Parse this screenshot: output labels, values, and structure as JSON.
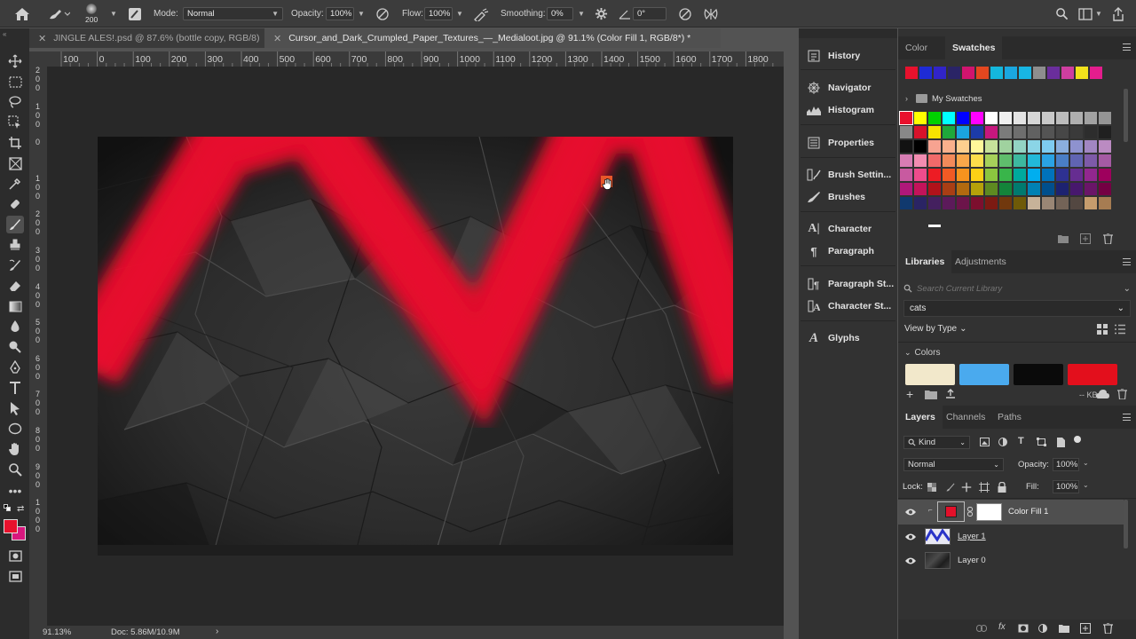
{
  "options_bar": {
    "brush_size": "200",
    "mode_label": "Mode:",
    "mode_value": "Normal",
    "opacity_label": "Opacity:",
    "opacity_value": "100%",
    "flow_label": "Flow:",
    "flow_value": "100%",
    "smoothing_label": "Smoothing:",
    "smoothing_value": "0%",
    "angle_value": "0°"
  },
  "tabs": [
    {
      "label": "JINGLE ALES!.psd @ 87.6% (bottle copy, RGB/8)",
      "active": false
    },
    {
      "label": "Cursor_and_Dark_Crumpled_Paper_Textures_—_Medialoot.jpg @ 91.1% (Color Fill 1, RGB/8*) *",
      "active": true
    }
  ],
  "ruler": {
    "top_ticks": [
      "100",
      "0",
      "100",
      "200",
      "300",
      "400",
      "500",
      "600",
      "700",
      "800",
      "900",
      "1000",
      "1100",
      "1200",
      "1300",
      "1400",
      "1500",
      "1600",
      "1700",
      "1800"
    ],
    "left_groups": [
      [
        "2",
        "0",
        "0"
      ],
      [
        "1",
        "0",
        "0"
      ],
      [
        "0"
      ],
      [
        "1",
        "0",
        "0"
      ],
      [
        "2",
        "0",
        "0"
      ],
      [
        "3",
        "0",
        "0"
      ],
      [
        "4",
        "0",
        "0"
      ],
      [
        "5",
        "0",
        "0"
      ],
      [
        "6",
        "0",
        "0"
      ],
      [
        "7",
        "0",
        "0"
      ],
      [
        "8",
        "0",
        "0"
      ],
      [
        "9",
        "0",
        "0"
      ],
      [
        "1",
        "0",
        "0",
        "0"
      ]
    ]
  },
  "status": {
    "zoom": "91.13%",
    "doc": "Doc: 5.86M/10.9M"
  },
  "mid_panel": [
    {
      "label": "History",
      "icon": "history-icon"
    },
    {
      "label": "Navigator",
      "icon": "navigator-icon"
    },
    {
      "label": "Histogram",
      "icon": "histogram-icon"
    },
    {
      "label": "Properties",
      "icon": "properties-icon"
    },
    {
      "label": "Brush Settin...",
      "icon": "brush-settings-icon"
    },
    {
      "label": "Brushes",
      "icon": "brushes-icon"
    },
    {
      "label": "Character",
      "icon": "character-icon"
    },
    {
      "label": "Paragraph",
      "icon": "paragraph-icon"
    },
    {
      "label": "Paragraph St...",
      "icon": "paragraph-styles-icon"
    },
    {
      "label": "Character St...",
      "icon": "character-styles-icon"
    },
    {
      "label": "Glyphs",
      "icon": "glyphs-icon"
    }
  ],
  "color_panel": {
    "tabs": [
      "Color",
      "Swatches"
    ],
    "recent": [
      "#e8112d",
      "#1e2bd6",
      "#3124c8",
      "#2a2466",
      "#d0146e",
      "#e4471f",
      "#14b7dc",
      "#1aa7e0",
      "#18b6e4",
      "#8e8e8e",
      "#6a2e9c",
      "#cf3ea0",
      "#f2e21b",
      "#e41d8d"
    ],
    "folder": "My Swatches",
    "grid_row1": [
      "#e8112d",
      "#ffff00",
      "#00d000",
      "#00ffff",
      "#0000ff",
      "#ff00ff",
      "#ffffff",
      "#f0f0f0",
      "#e3e3e3",
      "#d6d6d6",
      "#c9c9c9",
      "#bcbcbc",
      "#afafaf",
      "#a2a2a2",
      "#959595"
    ],
    "grid_row2": [
      "#888888",
      "#d8122a",
      "#f5e300",
      "#1fa83b",
      "#1aa4e0",
      "#1c3ba8",
      "#c6177e",
      "#7b7b7b",
      "#6e6e6e",
      "#616161",
      "#545454",
      "#474747",
      "#3a3a3a",
      "#2d2d2d",
      "#202020"
    ],
    "grid_row3": [
      "#121212",
      "#000000",
      "#f7a391",
      "#f9b08c",
      "#fdcf8f",
      "#fff79a",
      "#c7e19a",
      "#a0d29f",
      "#93d3c3",
      "#8bd5e6",
      "#7ecbf1",
      "#8aaede",
      "#8e92cf",
      "#a186c2",
      "#bb8bc2"
    ],
    "grid_row4": [
      "#d77db4",
      "#f28cb1",
      "#f26a6a",
      "#f38a5a",
      "#f9a74a",
      "#fdde4b",
      "#a6d05a",
      "#5fbd6c",
      "#3db89f",
      "#22b9d9",
      "#2aa2e4",
      "#4a7ec6",
      "#6064b2",
      "#7e5aa8",
      "#a55aa3"
    ],
    "grid_row5": [
      "#c85aa0",
      "#ee4c8c",
      "#ed1c24",
      "#f15a24",
      "#f7931e",
      "#fcd116",
      "#8cc63f",
      "#39b54a",
      "#00a99d",
      "#00aeef",
      "#0072bc",
      "#2e3192",
      "#662d91",
      "#92278f",
      "#9e005d"
    ],
    "grid_row6": [
      "#b0187a",
      "#c3135a",
      "#b1121a",
      "#a93e14",
      "#b26a0f",
      "#b6a10a",
      "#5e8a21",
      "#14843a",
      "#007a6f",
      "#0081b4",
      "#004f8d",
      "#1d2270",
      "#47186d",
      "#6a1568",
      "#740043"
    ],
    "grid_row7": [
      "#10396e",
      "#2a2464",
      "#44205f",
      "#5c1a5a",
      "#6c144a",
      "#7c0f2e",
      "#7c1a12",
      "#71380d",
      "#6e5a08",
      "#c7b299",
      "#998675",
      "#736357",
      "#534741",
      "#c69c6d",
      "#a67c52"
    ]
  },
  "libraries": {
    "tabs": [
      "Libraries",
      "Adjustments"
    ],
    "search_placeholder": "Search Current Library",
    "library_name": "cats",
    "view_by": "View by Type",
    "section": "Colors",
    "colors": [
      "#f2e8cb",
      "#4aaaee",
      "#0a0a0a",
      "#e30f1c"
    ],
    "size": "-- KB"
  },
  "layers_panel": {
    "tabs": [
      "Layers",
      "Channels",
      "Paths"
    ],
    "filter": "Kind",
    "blend": "Normal",
    "opacity_label": "Opacity:",
    "opacity_value": "100%",
    "lock_label": "Lock:",
    "fill_label": "Fill:",
    "fill_value": "100%",
    "layers": [
      {
        "name": "Color Fill 1",
        "selected": true
      },
      {
        "name": "Layer 1",
        "selected": false
      },
      {
        "name": "Layer 0",
        "selected": false
      }
    ]
  },
  "colors": {
    "foreground": "#e8112d",
    "background": "#d8177e",
    "accent": "#e30f2a"
  }
}
